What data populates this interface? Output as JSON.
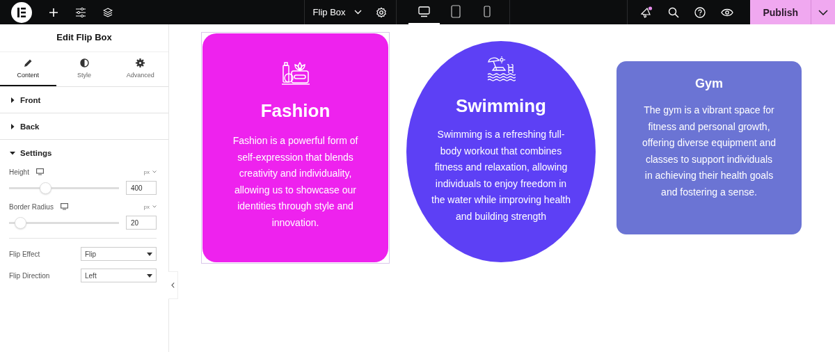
{
  "topbar": {
    "document": {
      "title": "Flip Box"
    },
    "devices": [
      {
        "kind": "desktop",
        "selected": true
      },
      {
        "kind": "tablet",
        "selected": false
      },
      {
        "kind": "mobile",
        "selected": false
      }
    ],
    "has_notification": true,
    "publish": "Publish"
  },
  "panel": {
    "title": "Edit Flip Box",
    "tabs": [
      {
        "kind": "content",
        "label": "Content",
        "selected": true
      },
      {
        "kind": "style",
        "label": "Style",
        "selected": false
      },
      {
        "kind": "advanced",
        "label": "Advanced",
        "selected": false
      }
    ],
    "sections": [
      {
        "label": "Front",
        "expanded": false
      },
      {
        "label": "Back",
        "expanded": false
      },
      {
        "label": "Settings",
        "expanded": true,
        "controls": [
          {
            "kind": "slider",
            "label": "Height",
            "unit": "px",
            "level": 0.33,
            "value": "400"
          },
          {
            "kind": "slider",
            "label": "Border Radius",
            "unit": "px",
            "level": 0.1,
            "value": "20"
          },
          {
            "kind": "select",
            "label": "Flip Effect",
            "value": "Flip"
          },
          {
            "kind": "select",
            "label": "Flip Direction",
            "value": "Left"
          }
        ]
      }
    ]
  },
  "cards": [
    {
      "kind": "tall",
      "selected": true,
      "color": "#ee22ee",
      "title": "Fashion",
      "text": "Fashion is a powerful form of self-expression that blends creativity and individuality, allowing us to showcase our identities through style and innovation."
    },
    {
      "kind": "round",
      "selected": false,
      "color": "#5d40f5",
      "title": "Swimming",
      "text": "Swimming is a refreshing full-body workout that combines fitness and relaxation, allowing individuals to enjoy freedom in the water while improving health and building strength"
    },
    {
      "kind": "plain",
      "selected": false,
      "color": "#6b74d4",
      "title": "Gym",
      "text": "The gym is a vibrant space for fitness and personal growth, offering diverse equipment and classes to support individuals in achieving their health goals and fostering a sense."
    }
  ]
}
